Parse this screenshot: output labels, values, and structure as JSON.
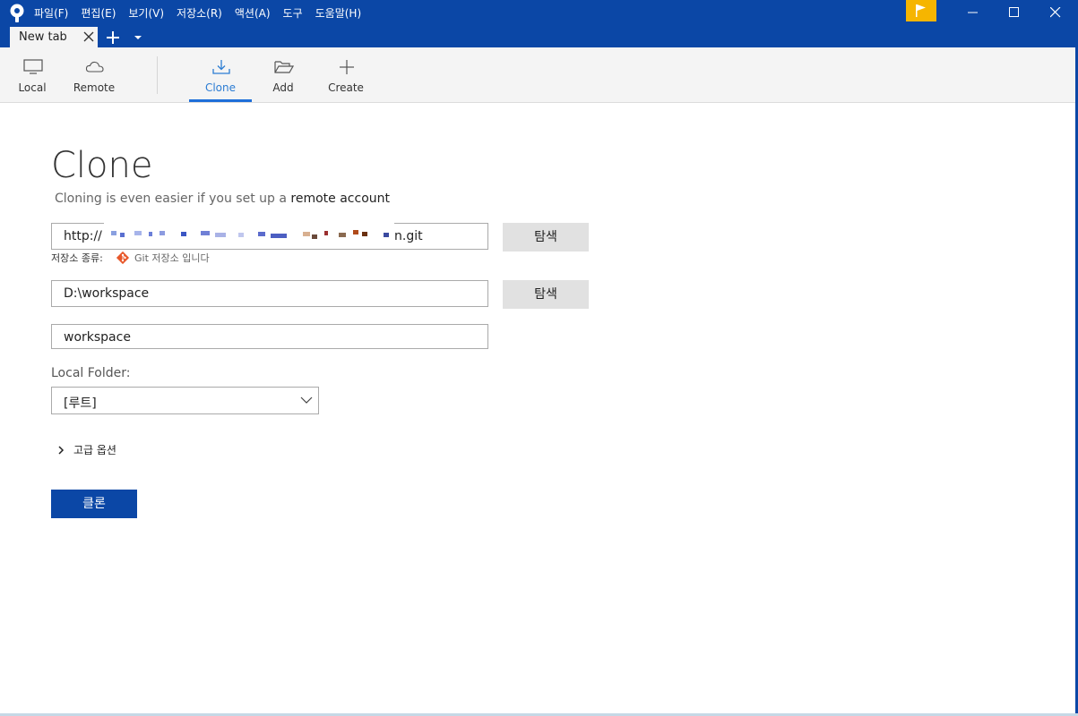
{
  "menu": {
    "file": "파일(F)",
    "edit": "편집(E)",
    "view": "보기(V)",
    "repository": "저장소(R)",
    "actions": "액션(A)",
    "tools": "도구",
    "help": "도움말(H)"
  },
  "tab": {
    "label": "New tab"
  },
  "toolbar": {
    "local": "Local",
    "remote": "Remote",
    "clone": "Clone",
    "add": "Add",
    "create": "Create"
  },
  "clone": {
    "title": "Clone",
    "subtitle_prefix": "Cloning is even easier if you set up a",
    "subtitle_link": "remote account",
    "url_value_start": "http://",
    "url_value_end": "n.git",
    "browse_label": "탐색",
    "repo_type_label": "저장소 종류:",
    "repo_type_value": "Git 저장소 입니다",
    "dest_path": "D:\\workspace",
    "name_value": "workspace",
    "local_folder_label": "Local Folder:",
    "local_folder_value": "[루트]",
    "advanced_label": "고급 옵션",
    "clone_button": "클론"
  },
  "colors": {
    "titlebar": "#0b47a6",
    "accent": "#1e6fd9",
    "flag": "#f6b500",
    "git": "#e8582b"
  }
}
